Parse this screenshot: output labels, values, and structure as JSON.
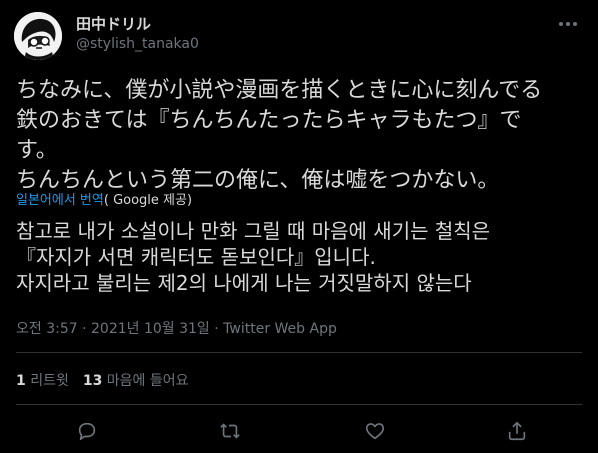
{
  "user": {
    "display_name": "田中ドリル",
    "handle": "@stylish_tanaka0",
    "avatar_icon": "user-avatar-icon"
  },
  "tweet": {
    "lines": [
      "ちなみに、僕が小説や漫画を描くときに心に刻んでる",
      "鉄のおきては『ちんちんたったらキャラもたつ』で",
      "す。",
      "ちんちんという第二の俺に、俺は嘘をつかない。"
    ]
  },
  "translation": {
    "label": "일본어에서 번역",
    "by": "( Google 제공)",
    "lines": [
      "참고로 내가 소설이나 만화 그릴 때 마음에 새기는 철칙은",
      "『자지가 서면 캐릭터도 돋보인다』입니다.",
      "자지라고 불리는 제2의 나에게 나는 거짓말하지 않는다"
    ]
  },
  "meta": {
    "text": "오전 3:57 · 2021년 10월 31일 · Twitter Web App"
  },
  "stats": {
    "retweets_count": "1",
    "retweets_label": "리트윗",
    "likes_count": "13",
    "likes_label": "마음에 들어요"
  },
  "icons": {
    "more": "more-icon",
    "reply": "reply-icon",
    "retweet": "retweet-icon",
    "like": "like-icon",
    "share": "share-icon"
  },
  "colors": {
    "background": "#000000",
    "text": "#d9d9d9",
    "secondary": "#6e767d",
    "link": "#1d9bf0",
    "divider": "#2f3336"
  }
}
